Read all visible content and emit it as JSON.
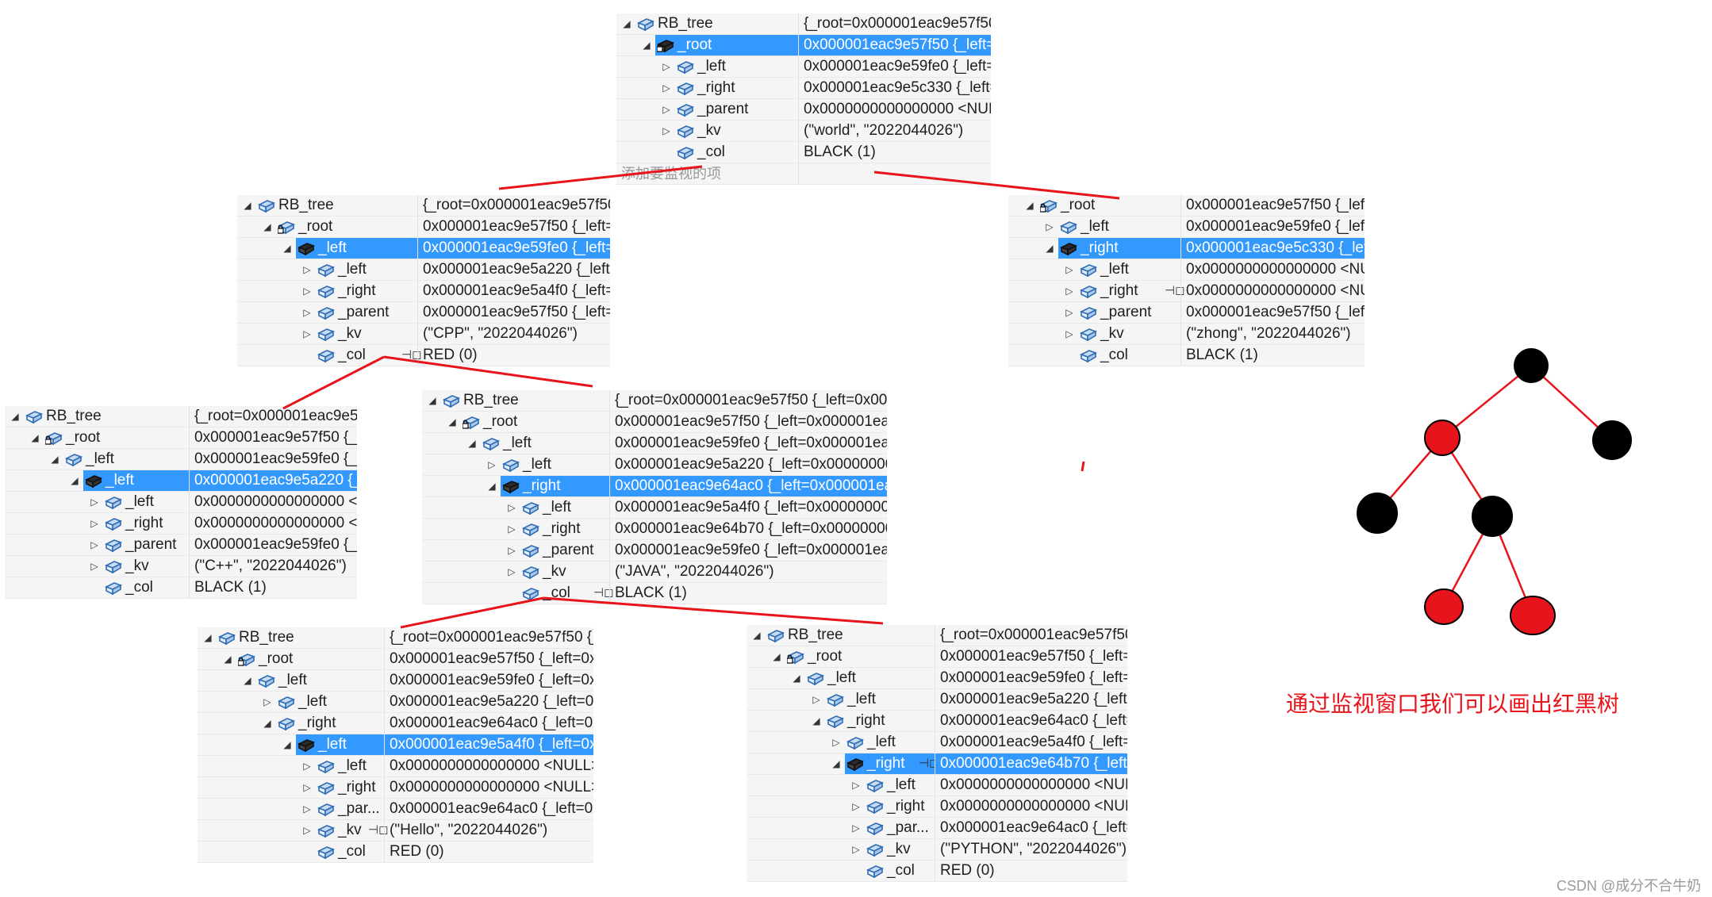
{
  "panels": [
    {
      "rows": [
        {
          "level": 0,
          "expand": "open",
          "icon": "struct",
          "name": "RB_tree",
          "value": "{_root=0x000001eac9e57f50 {"
        },
        {
          "level": 1,
          "expand": "open",
          "icon": "locked",
          "name": "_root",
          "value": "0x000001eac9e57f50 {_left=0x",
          "selected": true
        },
        {
          "level": 2,
          "expand": "closed",
          "icon": "struct",
          "name": "_left",
          "value": "0x000001eac9e59fe0 {_left=0x"
        },
        {
          "level": 2,
          "expand": "closed",
          "icon": "struct",
          "name": "_right",
          "value": "0x000001eac9e5c330 {_left=0"
        },
        {
          "level": 2,
          "expand": "closed",
          "icon": "struct",
          "name": "_parent",
          "value": "0x0000000000000000 <NULL"
        },
        {
          "level": 2,
          "expand": "closed",
          "icon": "struct",
          "name": "_kv",
          "value": "(\"world\", \"2022044026\")"
        },
        {
          "level": 2,
          "expand": "none",
          "icon": "struct",
          "name": "_col",
          "value": "BLACK (1)"
        },
        {
          "level": 0,
          "expand": "none",
          "icon": "none",
          "name": "添加要监视的项",
          "value": "",
          "ghost": true
        }
      ]
    },
    {
      "rows": [
        {
          "level": 0,
          "expand": "open",
          "icon": "struct",
          "name": "RB_tree",
          "value": "{_root=0x000001eac9e57f50 {"
        },
        {
          "level": 1,
          "expand": "open",
          "icon": "locked",
          "name": "_root",
          "value": "0x000001eac9e57f50 {_left=0x"
        },
        {
          "level": 2,
          "expand": "open",
          "icon": "struct",
          "name": "_left",
          "value": "0x000001eac9e59fe0 {_left=0x",
          "selected": true
        },
        {
          "level": 3,
          "expand": "closed",
          "icon": "struct",
          "name": "_left",
          "value": "0x000001eac9e5a220 {_left=0:"
        },
        {
          "level": 3,
          "expand": "closed",
          "icon": "struct",
          "name": "_right",
          "value": "0x000001eac9e5a4f0 {_left=0x"
        },
        {
          "level": 3,
          "expand": "closed",
          "icon": "struct",
          "name": "_parent",
          "value": "0x000001eac9e57f50 {_left=0x"
        },
        {
          "level": 3,
          "expand": "closed",
          "icon": "struct",
          "name": "_kv",
          "value": "(\"CPP\", \"2022044026\")"
        },
        {
          "level": 3,
          "expand": "none",
          "icon": "struct",
          "name": "_col",
          "value": "RED (0)",
          "pin": true
        }
      ]
    },
    {
      "rows": [
        {
          "level": 0,
          "expand": "open",
          "icon": "locked",
          "name": "_root",
          "value": "0x000001eac9e57f50 {_left="
        },
        {
          "level": 1,
          "expand": "closed",
          "icon": "struct",
          "name": "_left",
          "value": "0x000001eac9e59fe0 {_left="
        },
        {
          "level": 1,
          "expand": "open",
          "icon": "struct",
          "name": "_right",
          "value": "0x000001eac9e5c330 {_left=",
          "selected": true
        },
        {
          "level": 2,
          "expand": "closed",
          "icon": "struct",
          "name": "_left",
          "value": "0x0000000000000000 <NUL"
        },
        {
          "level": 2,
          "expand": "closed",
          "icon": "struct",
          "name": "_right",
          "value": "0x0000000000000000 <NUL",
          "pin": true
        },
        {
          "level": 2,
          "expand": "closed",
          "icon": "struct",
          "name": "_parent",
          "value": "0x000001eac9e57f50 {_left="
        },
        {
          "level": 2,
          "expand": "closed",
          "icon": "struct",
          "name": "_kv",
          "value": "(\"zhong\", \"2022044026\")"
        },
        {
          "level": 2,
          "expand": "none",
          "icon": "struct",
          "name": "_col",
          "value": "BLACK (1)"
        }
      ]
    },
    {
      "rows": [
        {
          "level": 0,
          "expand": "open",
          "icon": "struct",
          "name": "RB_tree",
          "value": "{_root=0x000001eac9e57f"
        },
        {
          "level": 1,
          "expand": "open",
          "icon": "locked",
          "name": "_root",
          "value": "0x000001eac9e57f50 {_lef"
        },
        {
          "level": 2,
          "expand": "open",
          "icon": "struct",
          "name": "_left",
          "value": "0x000001eac9e59fe0 {_lef"
        },
        {
          "level": 3,
          "expand": "open",
          "icon": "struct",
          "name": "_left",
          "value": "0x000001eac9e5a220 {_le",
          "selected": true
        },
        {
          "level": 4,
          "expand": "closed",
          "icon": "struct",
          "name": "_left",
          "value": "0x0000000000000000 <N"
        },
        {
          "level": 4,
          "expand": "closed",
          "icon": "struct",
          "name": "_right",
          "value": "0x0000000000000000 <N"
        },
        {
          "level": 4,
          "expand": "closed",
          "icon": "struct",
          "name": "_parent",
          "value": "0x000001eac9e59fe0 {_lef"
        },
        {
          "level": 4,
          "expand": "closed",
          "icon": "struct",
          "name": "_kv",
          "value": "(\"C++\", \"2022044026\")"
        },
        {
          "level": 4,
          "expand": "none",
          "icon": "struct",
          "name": "_col",
          "value": "BLACK (1)"
        }
      ]
    },
    {
      "rows": [
        {
          "level": 0,
          "expand": "open",
          "icon": "struct",
          "name": "RB_tree",
          "value": "{_root=0x000001eac9e57f50 {_left=0x000..."
        },
        {
          "level": 1,
          "expand": "open",
          "icon": "locked",
          "name": "_root",
          "value": "0x000001eac9e57f50 {_left=0x000001eac9..."
        },
        {
          "level": 2,
          "expand": "open",
          "icon": "struct",
          "name": "_left",
          "value": "0x000001eac9e59fe0 {_left=0x000001eac9..."
        },
        {
          "level": 3,
          "expand": "closed",
          "icon": "struct",
          "name": "_left",
          "value": "0x000001eac9e5a220 {_left=0x000000000..."
        },
        {
          "level": 3,
          "expand": "open",
          "icon": "struct",
          "name": "_right",
          "value": "0x000001eac9e64ac0 {_left=0x000001eac...",
          "selected": true
        },
        {
          "level": 4,
          "expand": "closed",
          "icon": "struct",
          "name": "_left",
          "value": "0x000001eac9e5a4f0 {_left=0x000000000..."
        },
        {
          "level": 4,
          "expand": "closed",
          "icon": "struct",
          "name": "_right",
          "value": "0x000001eac9e64b70 {_left=0x000000000..."
        },
        {
          "level": 4,
          "expand": "closed",
          "icon": "struct",
          "name": "_parent",
          "value": "0x000001eac9e59fe0 {_left=0x000001eac9..."
        },
        {
          "level": 4,
          "expand": "closed",
          "icon": "struct",
          "name": "_kv",
          "value": "(\"JAVA\", \"2022044026\")"
        },
        {
          "level": 4,
          "expand": "none",
          "icon": "struct",
          "name": "_col",
          "value": "BLACK (1)",
          "pin": true
        }
      ]
    },
    {
      "rows": [
        {
          "level": 0,
          "expand": "open",
          "icon": "struct",
          "name": "RB_tree",
          "value": "{_root=0x000001eac9e57f50 {_le"
        },
        {
          "level": 1,
          "expand": "open",
          "icon": "locked",
          "name": "_root",
          "value": "0x000001eac9e57f50 {_left=0x00"
        },
        {
          "level": 2,
          "expand": "open",
          "icon": "struct",
          "name": "_left",
          "value": "0x000001eac9e59fe0 {_left=0x00"
        },
        {
          "level": 3,
          "expand": "closed",
          "icon": "struct",
          "name": "_left",
          "value": "0x000001eac9e5a220 {_left=0x00"
        },
        {
          "level": 3,
          "expand": "open",
          "icon": "struct",
          "name": "_right",
          "value": "0x000001eac9e64ac0 {_left=0x00"
        },
        {
          "level": 4,
          "expand": "open",
          "icon": "struct",
          "name": "_left",
          "value": "0x000001eac9e5a4f0 {_left=0x00",
          "selected": true
        },
        {
          "level": 5,
          "expand": "closed",
          "icon": "struct",
          "name": "_left",
          "value": "0x0000000000000000 <NULL>"
        },
        {
          "level": 5,
          "expand": "closed",
          "icon": "struct",
          "name": "_right",
          "value": "0x0000000000000000 <NULL>"
        },
        {
          "level": 5,
          "expand": "closed",
          "icon": "struct",
          "name": "_par...",
          "value": "0x000001eac9e64ac0 {_left=0x00"
        },
        {
          "level": 5,
          "expand": "closed",
          "icon": "struct",
          "name": "_kv",
          "value": "(\"Hello\", \"2022044026\")",
          "pin": true
        },
        {
          "level": 5,
          "expand": "none",
          "icon": "struct",
          "name": "_col",
          "value": "RED (0)"
        }
      ]
    },
    {
      "rows": [
        {
          "level": 0,
          "expand": "open",
          "icon": "struct",
          "name": "RB_tree",
          "value": "{_root=0x000001eac9e57f50 {"
        },
        {
          "level": 1,
          "expand": "open",
          "icon": "locked",
          "name": "_root",
          "value": "0x000001eac9e57f50 {_left=0x"
        },
        {
          "level": 2,
          "expand": "open",
          "icon": "struct",
          "name": "_left",
          "value": "0x000001eac9e59fe0 {_left=0x"
        },
        {
          "level": 3,
          "expand": "closed",
          "icon": "struct",
          "name": "_left",
          "value": "0x000001eac9e5a220 {_left=0"
        },
        {
          "level": 3,
          "expand": "open",
          "icon": "struct",
          "name": "_right",
          "value": "0x000001eac9e64ac0 {_left=0x"
        },
        {
          "level": 4,
          "expand": "closed",
          "icon": "struct",
          "name": "_left",
          "value": "0x000001eac9e5a4f0 {_left=0x"
        },
        {
          "level": 4,
          "expand": "open",
          "icon": "struct",
          "name": "_right",
          "value": "0x000001eac9e64b70 {_left=0",
          "selected": true,
          "pin": true
        },
        {
          "level": 5,
          "expand": "closed",
          "icon": "struct",
          "name": "_left",
          "value": "0x0000000000000000 <NULL"
        },
        {
          "level": 5,
          "expand": "closed",
          "icon": "struct",
          "name": "_right",
          "value": "0x0000000000000000 <NULL"
        },
        {
          "level": 5,
          "expand": "closed",
          "icon": "struct",
          "name": "_par...",
          "value": "0x000001eac9e64ac0 {_left=0"
        },
        {
          "level": 5,
          "expand": "closed",
          "icon": "struct",
          "name": "_kv",
          "value": "(\"PYTHON\", \"2022044026\")"
        },
        {
          "level": 5,
          "expand": "none",
          "icon": "struct",
          "name": "_col",
          "value": "RED (0)"
        }
      ]
    }
  ],
  "tree_diagram": {
    "nodes": [
      {
        "color": "black"
      },
      {
        "color": "red"
      },
      {
        "color": "black"
      },
      {
        "color": "black"
      },
      {
        "color": "black"
      },
      {
        "color": "red"
      },
      {
        "color": "red"
      }
    ],
    "edge_color": "#e8141b"
  },
  "caption": "通过监视窗口我们可以画出红黑树",
  "watermark": "CSDN @成分不合牛奶",
  "colors": {
    "selection": "#3399ff",
    "annotation_red": "#e8141b"
  }
}
